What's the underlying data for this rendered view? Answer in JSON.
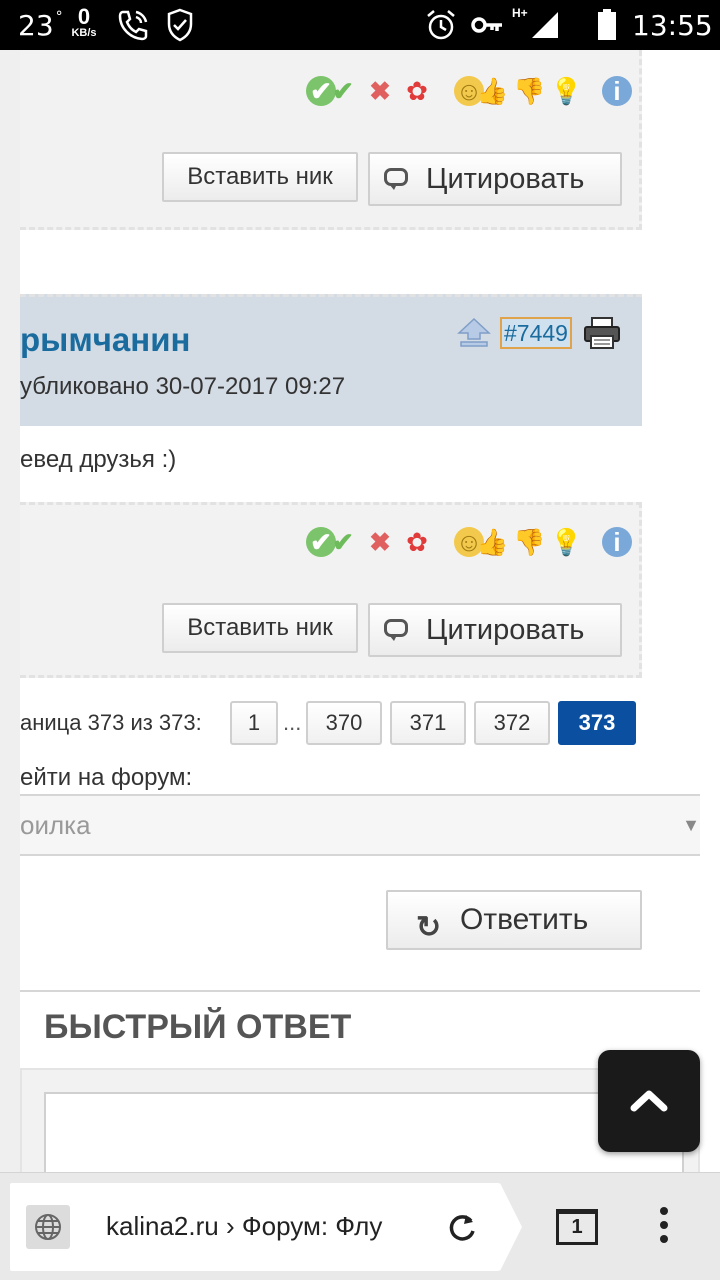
{
  "status_bar": {
    "temperature": "23",
    "degree": "°",
    "net_speed_value": "0",
    "net_speed_unit": "KB/s",
    "network_type": "H+",
    "time": "13:55"
  },
  "post_prev": {
    "insert_nick_label": "Вставить ник",
    "quote_label": "Цитировать"
  },
  "post": {
    "author": "рымчанин",
    "published": "убликовано 30-07-2017 09:27",
    "post_number": "#7449",
    "text": "евед друзья :)",
    "insert_nick_label": "Вставить ник",
    "quote_label": "Цитировать"
  },
  "reputation_icons": [
    "check-circle-icon",
    "check-icon",
    "cross-icon",
    "award-icon",
    "smile-icon",
    "thumbs-up-icon",
    "thumbs-down-icon",
    "lightbulb-icon",
    "info-icon"
  ],
  "pagination": {
    "label": "аница 373 из 373:",
    "ellipsis": "...",
    "pages": [
      "1",
      "370",
      "371",
      "372",
      "373"
    ],
    "active_page": "373"
  },
  "forum_jump": {
    "label": "ейти на форум:",
    "selected": "оилка"
  },
  "reply_label": "Ответить",
  "quick_reply_title": "БЫСТРЫЙ ОТВЕТ",
  "browser": {
    "url": "kalina2.ru › Форум: Флу",
    "tab_count": "1"
  },
  "colors": {
    "accent": "#0b4fa1",
    "author": "#1a6b9e",
    "post_header_bg": "#d3dbe5"
  }
}
